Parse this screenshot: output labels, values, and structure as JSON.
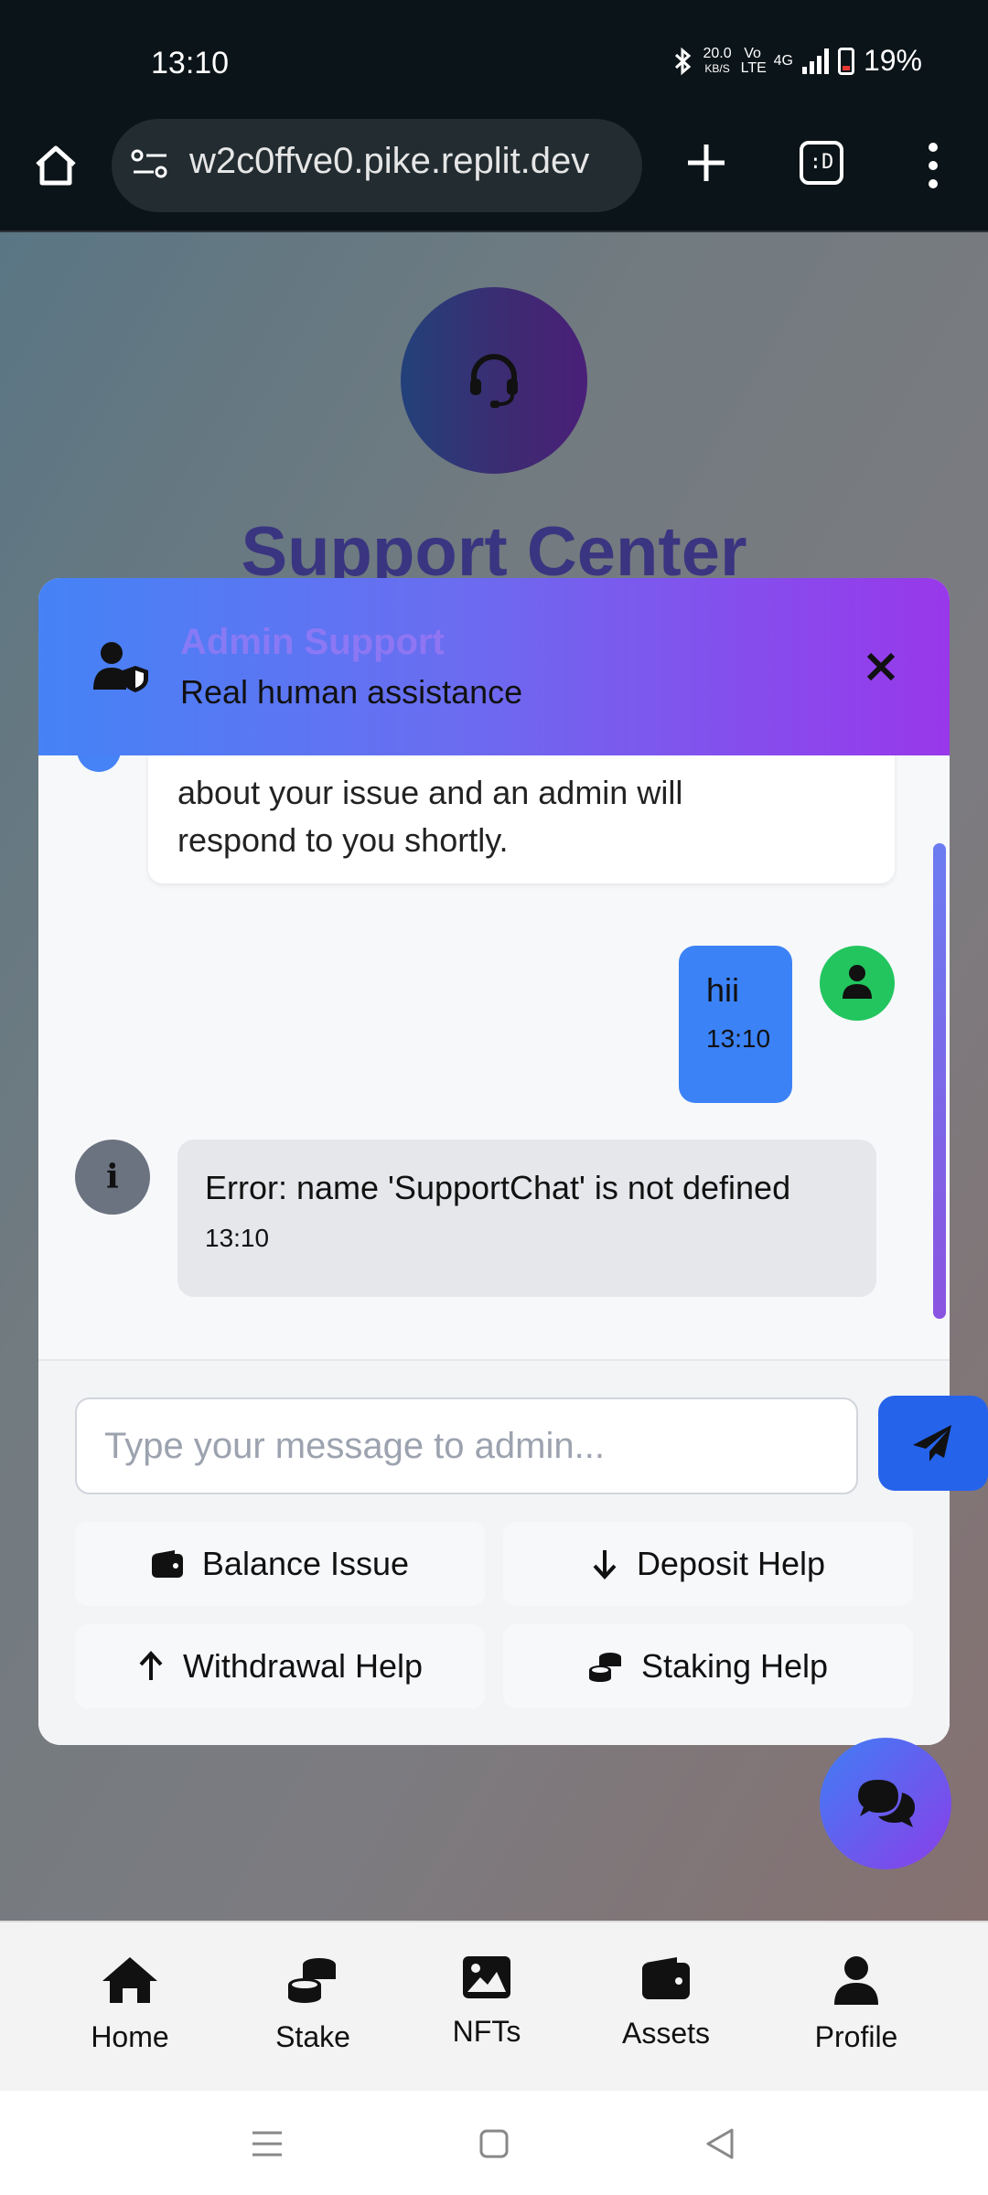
{
  "status_bar": {
    "time": "13:10",
    "net_speed": "20.0",
    "net_unit": "KB/S",
    "volte": "Vo LTE",
    "signal": "4G",
    "battery": "19%"
  },
  "browser": {
    "url": "w2c0ffve0.pike.replit.dev",
    "tabs_label": ":D"
  },
  "page": {
    "title": "Support Center"
  },
  "chat": {
    "title": "Admin Support",
    "subtitle": "Real human assistance",
    "messages": {
      "admin_intro": {
        "text_line1": "about your issue and an admin will",
        "text_line2": "respond to you shortly."
      },
      "user": {
        "text": "hii",
        "time": "13:10"
      },
      "system": {
        "text": "Error: name 'SupportChat' is not defined",
        "time": "13:10"
      }
    },
    "input_placeholder": "Type your message to admin...",
    "quick_actions": {
      "balance": "Balance Issue",
      "deposit": "Deposit Help",
      "withdrawal": "Withdrawal Help",
      "staking": "Staking Help"
    }
  },
  "bottom_nav": {
    "home": "Home",
    "stake": "Stake",
    "nfts": "NFTs",
    "assets": "Assets",
    "profile": "Profile"
  },
  "colors": {
    "header_gradient_start": "#4583f6",
    "header_gradient_end": "#9838ea",
    "user_bubble": "#3b82f6",
    "send_button": "#2563eb",
    "user_avatar": "#22c55e"
  }
}
